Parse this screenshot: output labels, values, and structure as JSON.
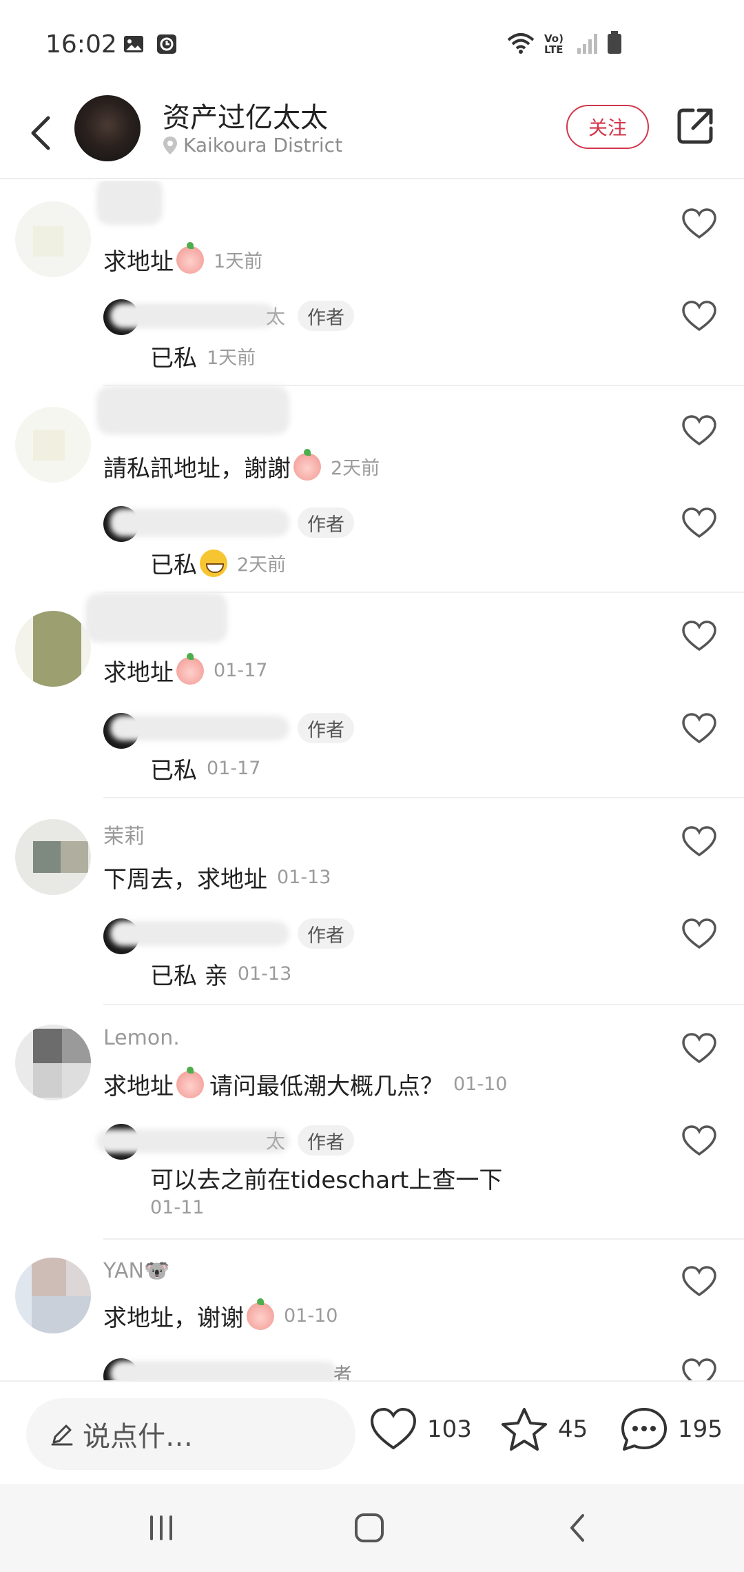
{
  "status_bar": {
    "time": "16:02",
    "network_label": "Vo) LTE"
  },
  "header": {
    "username": "资产过亿太太",
    "location": "Kaikoura District",
    "follow_label": "关注"
  },
  "comments": [
    {
      "username": "",
      "text": "求地址",
      "emoji": "pleading-peach-emoji",
      "time": "1天前",
      "reply": {
        "name_fragment": "太",
        "badge": "作者",
        "text": "已私",
        "time": "1天前"
      }
    },
    {
      "username": "",
      "text": "請私訊地址，謝謝",
      "emoji": "blowing-kiss-peach-emoji",
      "time": "2天前",
      "reply": {
        "name_fragment": "",
        "badge": "作者",
        "text": "已私",
        "time": "2天前"
      }
    },
    {
      "username": "",
      "text": "求地址",
      "emoji": "pleading-peach-emoji",
      "time": "01-17",
      "reply": {
        "name_fragment": "",
        "badge": "作者",
        "text": "已私",
        "time": "01-17"
      }
    },
    {
      "username": "茉莉",
      "text": "下周去，求地址",
      "time": "01-13",
      "reply": {
        "name_fragment": "",
        "badge": "作者",
        "text": "已私 亲",
        "time": "01-13"
      }
    },
    {
      "username": "Lemon.",
      "text_before": "求地址",
      "text_after": "请问最低潮大概几点？",
      "emoji": "pleading-peach-emoji",
      "time": "01-10",
      "reply": {
        "name_fragment": "太",
        "badge": "作者",
        "text": "可以去之前在tideschart上查一下",
        "time": "01-11"
      }
    },
    {
      "username": "YAN🐨",
      "text": "求地址，谢谢",
      "emoji": "blowing-kiss-peach-emoji",
      "time": "01-10",
      "reply": {
        "name_fragment": "",
        "badge": "者",
        "text": "",
        "time": ""
      }
    }
  ],
  "bottom_bar": {
    "input_placeholder": "说点什…",
    "likes": "103",
    "stars": "45",
    "comments": "195"
  },
  "colors": {
    "accent": "#d3364b",
    "muted_text": "#999999",
    "divider": "#efefef"
  }
}
